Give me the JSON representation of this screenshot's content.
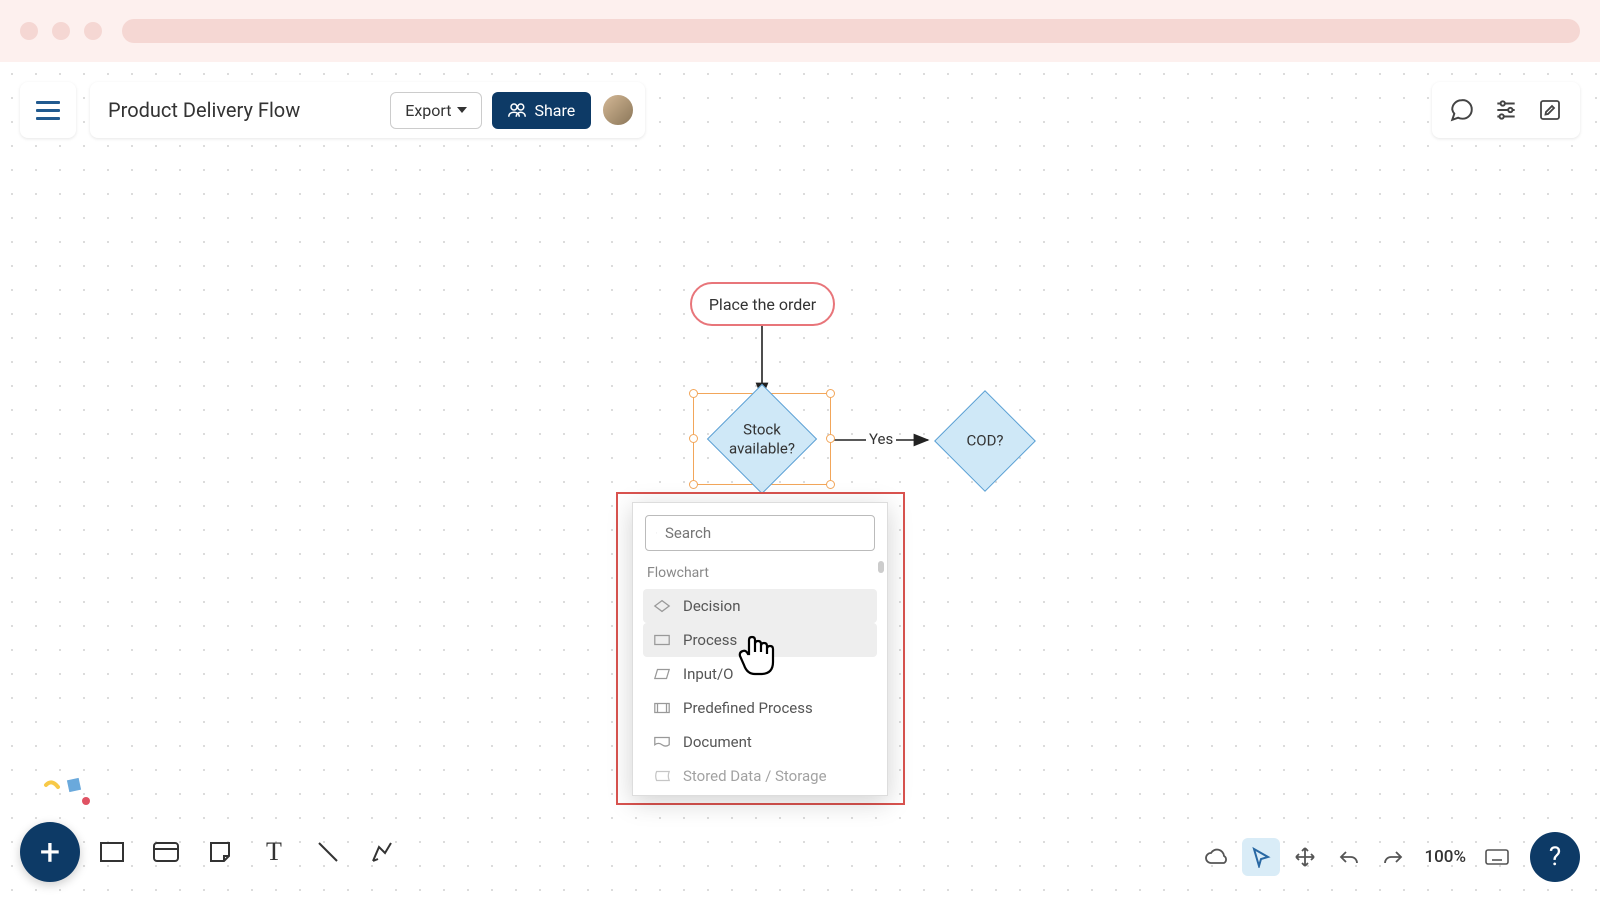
{
  "header": {
    "title": "Product Delivery Flow",
    "export_label": "Export",
    "share_label": "Share"
  },
  "nodes": {
    "start": "Place the order",
    "stock": "Stock\navailable?",
    "cod": "COD?",
    "edge_yes": "Yes"
  },
  "picker": {
    "search_placeholder": "Search",
    "category": "Flowchart",
    "items": [
      "Decision",
      "Process",
      "Input/O",
      "Predefined Process",
      "Document",
      "Stored Data / Storage"
    ]
  },
  "bottom": {
    "zoom": "100%"
  }
}
